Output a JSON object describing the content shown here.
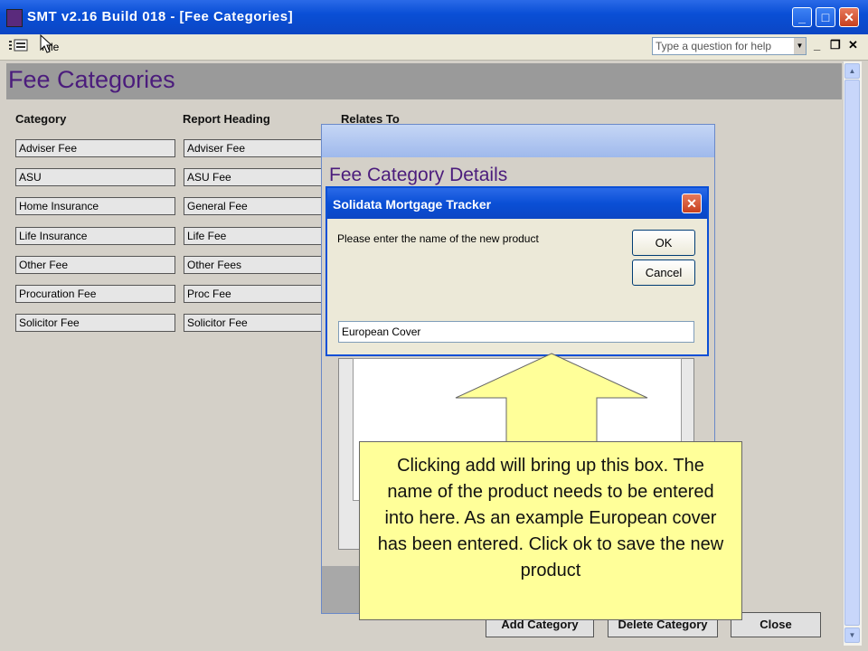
{
  "window": {
    "title": "SMT v2.16 Build 018 - [Fee Categories]",
    "minimize": "_",
    "maximize": "□",
    "close": "✕"
  },
  "menubar": {
    "file_label": "File",
    "help_placeholder": "Type a question for help",
    "mdi_min": "_",
    "mdi_restore": "❐",
    "mdi_close": "✕"
  },
  "form": {
    "title": "Fee Categories",
    "columns": {
      "category": "Category",
      "report_heading": "Report Heading",
      "relates_to": "Relates To"
    },
    "rows": [
      {
        "category": "Adviser Fee",
        "report_heading": "Adviser Fee"
      },
      {
        "category": "ASU",
        "report_heading": "ASU Fee"
      },
      {
        "category": "Home Insurance",
        "report_heading": "General Fee"
      },
      {
        "category": "Life Insurance",
        "report_heading": "Life Fee"
      },
      {
        "category": "Other Fee",
        "report_heading": "Other Fees"
      },
      {
        "category": "Procuration Fee",
        "report_heading": "Proc Fee"
      },
      {
        "category": "Solicitor Fee",
        "report_heading": "Solicitor Fee"
      }
    ],
    "buttons": {
      "add": "Add Category",
      "delete": "Delete Category",
      "close": "Close"
    }
  },
  "details_window": {
    "title": "Fee Category Details"
  },
  "dialog": {
    "title": "Solidata Mortgage Tracker",
    "prompt": "Please enter the name of the new product",
    "ok_label": "OK",
    "cancel_label": "Cancel",
    "input_value": "European Cover"
  },
  "callout": {
    "text": "Clicking add will bring up this box. The name of the product needs to be entered into here. As an example European cover has been entered. Click ok to save the new product"
  },
  "colors": {
    "titlebar": "#0a4fd6",
    "form_title": "#4b1c7c",
    "callout": "#ffff99"
  }
}
